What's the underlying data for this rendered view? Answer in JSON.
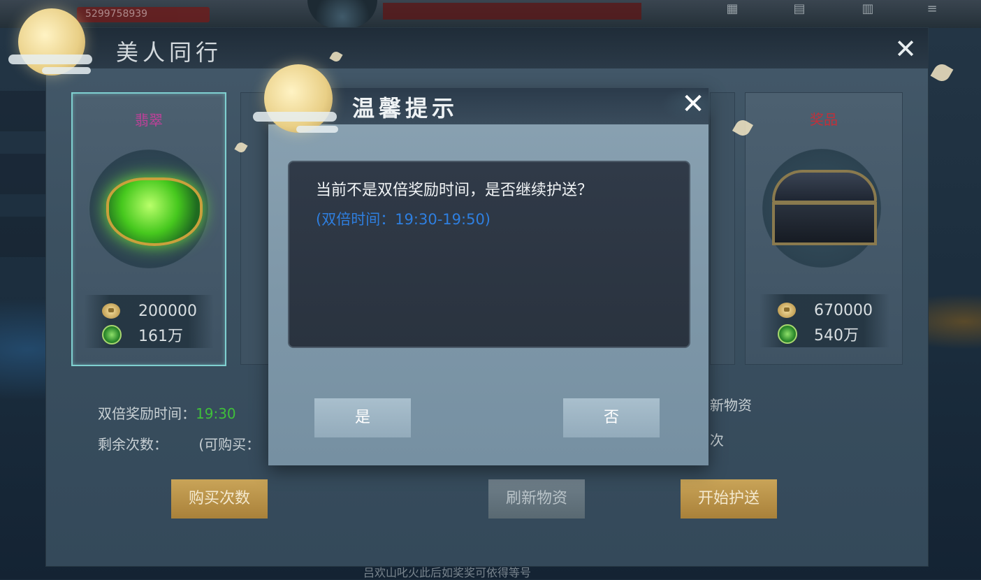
{
  "background": {
    "player_id": "5299758939",
    "bottom_hint": "吕欢山叱火此后如奖奖可依得等号"
  },
  "panel": {
    "title": "美人同行",
    "cards": [
      {
        "name": "翡翠",
        "name_color": "#c0409a",
        "cost_coin": "200000",
        "cost_jade": "161万",
        "selected": true
      },
      {
        "name": "奖品",
        "name_color": "#c0303a",
        "cost_coin": "670000",
        "cost_jade": "540万",
        "selected": false
      }
    ],
    "double_time_label": "双倍奖励时间：",
    "double_time_value": "19:30",
    "remaining_label": "剩余次数：",
    "purchasable_label": "(可购买：",
    "right_label_1": "新物资",
    "right_label_2": "次",
    "buttons": {
      "buy": "购买次数",
      "refresh": "刷新物资",
      "start": "开始护送"
    }
  },
  "modal": {
    "title": "温馨提示",
    "message": "当前不是双倍奖励时间，是否继续护送？",
    "sub_message": "(双倍时间：19:30-19:50)",
    "yes_label": "是",
    "no_label": "否"
  },
  "colors": {
    "accent_gold": "#c9a458",
    "link_blue": "#2e7fe0",
    "highlight_green": "#3fbf3a"
  }
}
